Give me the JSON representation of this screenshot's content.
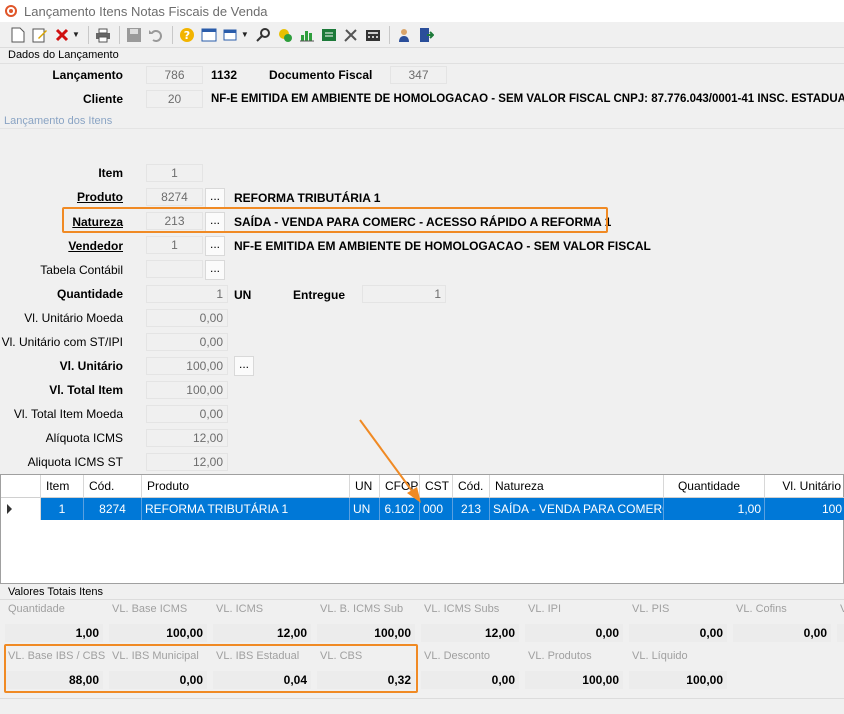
{
  "window": {
    "title": "Lançamento Itens Notas Fiscais de Venda"
  },
  "toolbar": {
    "icons": [
      "new-icon",
      "edit-icon",
      "delete-icon",
      "print-icon",
      "save-icon",
      "undo-icon",
      "help-icon",
      "calendar-icon",
      "window-icon",
      "search-icon",
      "attach-icon",
      "chart-icon",
      "spreadsheet-icon",
      "tools-icon",
      "calculator-icon",
      "user-icon",
      "exit-icon"
    ]
  },
  "dados": {
    "group_title": "Dados do Lançamento",
    "lancamento_label": "Lançamento",
    "lancamento_value": "786",
    "lancamento_number": "1132",
    "documento_label": "Documento Fiscal",
    "documento_value": "347",
    "cliente_label": "Cliente",
    "cliente_value": "20",
    "cliente_desc": "NF-E EMITIDA EM AMBIENTE DE HOMOLOGACAO - SEM VALOR FISCAL  CNPJ: 87.776.043/0001-41  INSC. ESTADUAL:"
  },
  "itens": {
    "group_title": "Lançamento dos Itens",
    "item_label": "Item",
    "item_value": "1",
    "produto_label": "Produto",
    "produto_value": "8274",
    "produto_desc": "REFORMA TRIBUTÁRIA 1",
    "natureza_label": "Natureza",
    "natureza_value": "213",
    "natureza_desc": "SAÍDA - VENDA PARA COMERC - ACESSO RÁPIDO A REFORMA 1",
    "vendedor_label": "Vendedor",
    "vendedor_value": "1",
    "vendedor_desc": "NF-E EMITIDA EM AMBIENTE DE HOMOLOGACAO - SEM VALOR FISCAL",
    "tabela_label": "Tabela Contábil",
    "tabela_value": "",
    "quantidade_label": "Quantidade",
    "quantidade_value": "1",
    "unidade": "UN",
    "entregue_label": "Entregue",
    "entregue_value": "1",
    "vl_unit_moeda_label": "Vl. Unitário Moeda",
    "vl_unit_moeda_value": "0,00",
    "vl_unit_st_label": "Vl. Unitário com ST/IPI",
    "vl_unit_st_value": "0,00",
    "vl_unit_label": "Vl. Unitário",
    "vl_unit_value": "100,00",
    "vl_total_label": "Vl. Total Item",
    "vl_total_value": "100,00",
    "vl_total_moeda_label": "Vl. Total Item Moeda",
    "vl_total_moeda_value": "0,00",
    "aliq_icms_label": "Alíquota ICMS",
    "aliq_icms_value": "12,00",
    "aliq_icms_st_label": "Aliquota ICMS ST",
    "aliq_icms_st_value": "12,00",
    "browse_label": "..."
  },
  "grid": {
    "columns": [
      "Item",
      "Cód.",
      "Produto",
      "UN",
      "CFOP",
      "CST",
      "Cód.",
      "Natureza",
      "Quantidade",
      "Vl. Unitário"
    ],
    "row": [
      "1",
      "8274",
      "REFORMA TRIBUTÁRIA 1",
      "UN",
      "6.102",
      "000",
      "213",
      "SAÍDA - VENDA PARA COMERC ...",
      "1,00",
      "100"
    ]
  },
  "totais": {
    "group_title": "Valores Totais Itens",
    "row1": [
      {
        "label": "Quantidade",
        "value": "1,00"
      },
      {
        "label": "VL. Base ICMS",
        "value": "100,00"
      },
      {
        "label": "VL. ICMS",
        "value": "12,00"
      },
      {
        "label": "VL. B. ICMS Sub",
        "value": "100,00"
      },
      {
        "label": "VL. ICMS Subs",
        "value": "12,00"
      },
      {
        "label": "VL. IPI",
        "value": "0,00"
      },
      {
        "label": "VL. PIS",
        "value": "0,00"
      },
      {
        "label": "VL. Cofins",
        "value": "0,00"
      },
      {
        "label": "V",
        "value": ""
      }
    ],
    "row2": [
      {
        "label": "VL. Base IBS / CBS",
        "value": "88,00"
      },
      {
        "label": "VL. IBS Municipal",
        "value": "0,00"
      },
      {
        "label": "VL. IBS Estadual",
        "value": "0,04"
      },
      {
        "label": "VL. CBS",
        "value": "0,32"
      },
      {
        "label": "VL. Desconto",
        "value": "0,00"
      },
      {
        "label": "VL. Produtos",
        "value": "100,00"
      },
      {
        "label": "VL. Líquido",
        "value": "100,00"
      }
    ]
  },
  "colors": {
    "accent": "#0078d7",
    "highlight": "#f08a24"
  }
}
